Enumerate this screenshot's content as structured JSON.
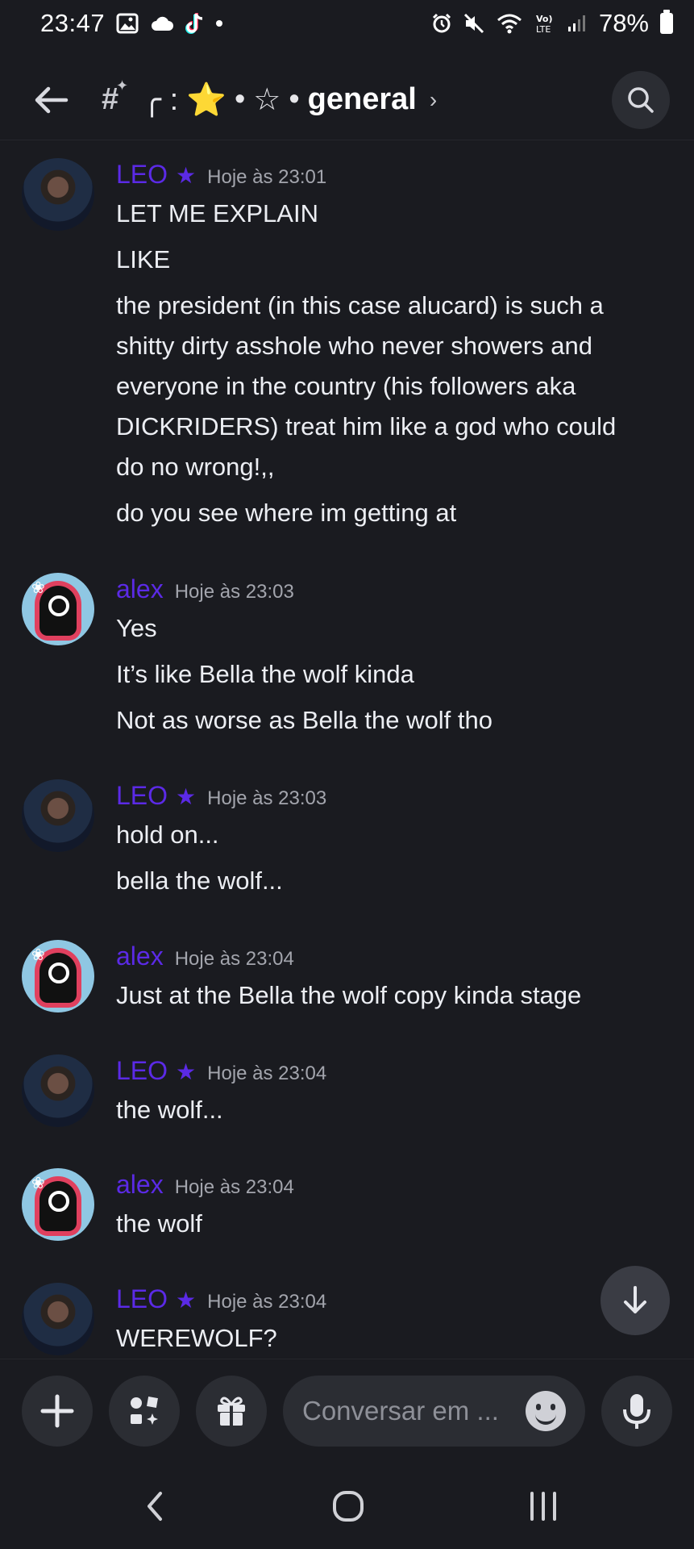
{
  "status": {
    "time": "23:47",
    "battery": "78%",
    "icons": [
      "image-icon",
      "cloud-icon",
      "tiktok-icon",
      "dot-icon",
      "alarm-icon",
      "mute-icon",
      "wifi-icon",
      "volte-icon",
      "signal-icon",
      "battery-icon"
    ]
  },
  "header": {
    "hash": "#",
    "channel_prefix": "╭ : ",
    "star_emoji": "⭐",
    "separator1": "•",
    "outline_star": "☆",
    "separator2": "•",
    "channel_name": "general",
    "chevron": "›"
  },
  "messages": [
    {
      "author": "LEO",
      "author_badge": "★",
      "time": "Hoje às 23:01",
      "avatar": "leo",
      "lines": [
        "LET ME EXPLAIN",
        "LIKE",
        "the president (in this case alucard) is such a",
        "shitty dirty asshole who never showers and",
        "everyone in the country (his followers aka",
        "DICKRIDERS) treat him like a god who could",
        "do no wrong!,,",
        "do you see where im getting at"
      ]
    },
    {
      "author": "alex",
      "author_badge": "",
      "time": "Hoje às 23:03",
      "avatar": "alex",
      "lines": [
        "Yes",
        "It’s like Bella the wolf kinda",
        "Not as worse as Bella the wolf tho"
      ]
    },
    {
      "author": "LEO",
      "author_badge": "★",
      "time": "Hoje às 23:03",
      "avatar": "leo",
      "lines": [
        "hold on...",
        "bella the wolf..."
      ]
    },
    {
      "author": "alex",
      "author_badge": "",
      "time": "Hoje às 23:04",
      "avatar": "alex",
      "lines": [
        "Just at the Bella the wolf copy kinda stage"
      ]
    },
    {
      "author": "LEO",
      "author_badge": "★",
      "time": "Hoje às 23:04",
      "avatar": "leo",
      "lines": [
        "the wolf..."
      ]
    },
    {
      "author": "alex",
      "author_badge": "",
      "time": "Hoje às 23:04",
      "avatar": "alex",
      "lines": [
        "the wolf"
      ]
    },
    {
      "author": "LEO",
      "author_badge": "★",
      "time": "Hoje às 23:04",
      "avatar": "leo",
      "lines": [
        "WEREWOLF?"
      ]
    }
  ],
  "composer": {
    "placeholder": "Conversar em ..."
  },
  "colors": {
    "background": "#1a1b20",
    "author": "#5b2ae6",
    "surface": "#2b2d33",
    "star_gold": "#f6c533"
  }
}
